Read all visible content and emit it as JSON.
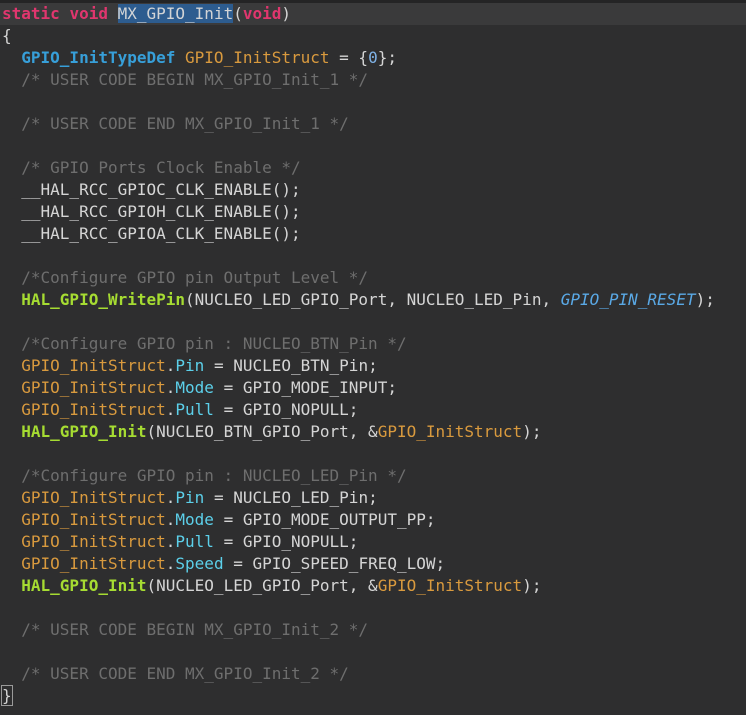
{
  "app": {
    "type": "code-editor-viewport",
    "language": "C",
    "function_shown": "MX_GPIO_Init",
    "selected_word": "MX_GPIO_Init"
  },
  "editor": {
    "palette": {
      "bg": "#2e2e2f",
      "top_strip": "#242425",
      "current_line": "#3a3a3b",
      "pl": "#d5d5d5",
      "kw": "#e0366e",
      "type": "#379fd9",
      "fn": "#a6dc32",
      "var": "#d99a3e",
      "prop": "#5cd0ea",
      "enum": "#5aa9e6",
      "num": "#7fb2e6",
      "comment": "#6e6e6e",
      "sel_bg": "#2d5c8f",
      "sel_text": "#d2d4d6",
      "brace_border": "#9a9a9a"
    },
    "lines": [
      {
        "current": true,
        "t": [
          [
            "kw",
            "static"
          ],
          [
            "pl",
            " "
          ],
          [
            "kw",
            "void"
          ],
          [
            "pl",
            " "
          ],
          [
            "sel",
            "MX_GPIO_Init"
          ],
          [
            "pl",
            "("
          ],
          [
            "kw",
            "void"
          ],
          [
            "pl",
            ")"
          ]
        ]
      },
      {
        "t": [
          [
            "pl",
            "{"
          ]
        ]
      },
      {
        "t": [
          [
            "pl",
            "  "
          ],
          [
            "type",
            "GPIO_InitTypeDef"
          ],
          [
            "pl",
            " "
          ],
          [
            "var",
            "GPIO_InitStruct"
          ],
          [
            "pl",
            " = {"
          ],
          [
            "num",
            "0"
          ],
          [
            "pl",
            "};"
          ]
        ]
      },
      {
        "t": [
          [
            "comment",
            "  /* USER CODE BEGIN MX_GPIO_Init_1 */"
          ]
        ]
      },
      {
        "t": []
      },
      {
        "t": [
          [
            "comment",
            "  /* USER CODE END MX_GPIO_Init_1 */"
          ]
        ]
      },
      {
        "t": []
      },
      {
        "t": [
          [
            "comment",
            "  /* GPIO Ports Clock Enable */"
          ]
        ]
      },
      {
        "t": [
          [
            "pl",
            "  __HAL_RCC_GPIOC_CLK_ENABLE();"
          ]
        ]
      },
      {
        "t": [
          [
            "pl",
            "  __HAL_RCC_GPIOH_CLK_ENABLE();"
          ]
        ]
      },
      {
        "t": [
          [
            "pl",
            "  __HAL_RCC_GPIOA_CLK_ENABLE();"
          ]
        ]
      },
      {
        "t": []
      },
      {
        "t": [
          [
            "comment",
            "  /*Configure GPIO pin Output Level */"
          ]
        ]
      },
      {
        "t": [
          [
            "pl",
            "  "
          ],
          [
            "fn",
            "HAL_GPIO_WritePin"
          ],
          [
            "pl",
            "(NUCLEO_LED_GPIO_Port, NUCLEO_LED_Pin, "
          ],
          [
            "enum",
            "GPIO_PIN_RESET"
          ],
          [
            "pl",
            ");"
          ]
        ]
      },
      {
        "t": []
      },
      {
        "t": [
          [
            "comment",
            "  /*Configure GPIO pin : NUCLEO_BTN_Pin */"
          ]
        ]
      },
      {
        "t": [
          [
            "pl",
            "  "
          ],
          [
            "var",
            "GPIO_InitStruct"
          ],
          [
            "pl",
            "."
          ],
          [
            "prop",
            "Pin"
          ],
          [
            "pl",
            " = NUCLEO_BTN_Pin;"
          ]
        ]
      },
      {
        "t": [
          [
            "pl",
            "  "
          ],
          [
            "var",
            "GPIO_InitStruct"
          ],
          [
            "pl",
            "."
          ],
          [
            "prop",
            "Mode"
          ],
          [
            "pl",
            " = GPIO_MODE_INPUT;"
          ]
        ]
      },
      {
        "t": [
          [
            "pl",
            "  "
          ],
          [
            "var",
            "GPIO_InitStruct"
          ],
          [
            "pl",
            "."
          ],
          [
            "prop",
            "Pull"
          ],
          [
            "pl",
            " = GPIO_NOPULL;"
          ]
        ]
      },
      {
        "t": [
          [
            "pl",
            "  "
          ],
          [
            "fn",
            "HAL_GPIO_Init"
          ],
          [
            "pl",
            "(NUCLEO_BTN_GPIO_Port, &"
          ],
          [
            "var",
            "GPIO_InitStruct"
          ],
          [
            "pl",
            ");"
          ]
        ]
      },
      {
        "t": []
      },
      {
        "t": [
          [
            "comment",
            "  /*Configure GPIO pin : NUCLEO_LED_Pin */"
          ]
        ]
      },
      {
        "t": [
          [
            "pl",
            "  "
          ],
          [
            "var",
            "GPIO_InitStruct"
          ],
          [
            "pl",
            "."
          ],
          [
            "prop",
            "Pin"
          ],
          [
            "pl",
            " = NUCLEO_LED_Pin;"
          ]
        ]
      },
      {
        "t": [
          [
            "pl",
            "  "
          ],
          [
            "var",
            "GPIO_InitStruct"
          ],
          [
            "pl",
            "."
          ],
          [
            "prop",
            "Mode"
          ],
          [
            "pl",
            " = GPIO_MODE_OUTPUT_PP;"
          ]
        ]
      },
      {
        "t": [
          [
            "pl",
            "  "
          ],
          [
            "var",
            "GPIO_InitStruct"
          ],
          [
            "pl",
            "."
          ],
          [
            "prop",
            "Pull"
          ],
          [
            "pl",
            " = GPIO_NOPULL;"
          ]
        ]
      },
      {
        "t": [
          [
            "pl",
            "  "
          ],
          [
            "var",
            "GPIO_InitStruct"
          ],
          [
            "pl",
            "."
          ],
          [
            "prop",
            "Speed"
          ],
          [
            "pl",
            " = GPIO_SPEED_FREQ_LOW;"
          ]
        ]
      },
      {
        "t": [
          [
            "pl",
            "  "
          ],
          [
            "fn",
            "HAL_GPIO_Init"
          ],
          [
            "pl",
            "(NUCLEO_LED_GPIO_Port, &"
          ],
          [
            "var",
            "GPIO_InitStruct"
          ],
          [
            "pl",
            ");"
          ]
        ]
      },
      {
        "t": []
      },
      {
        "t": [
          [
            "comment",
            "  /* USER CODE BEGIN MX_GPIO_Init_2 */"
          ]
        ]
      },
      {
        "t": []
      },
      {
        "t": [
          [
            "comment",
            "  /* USER CODE END MX_GPIO_Init_2 */"
          ]
        ]
      },
      {
        "t": [
          [
            "brace",
            "}"
          ]
        ]
      }
    ]
  }
}
